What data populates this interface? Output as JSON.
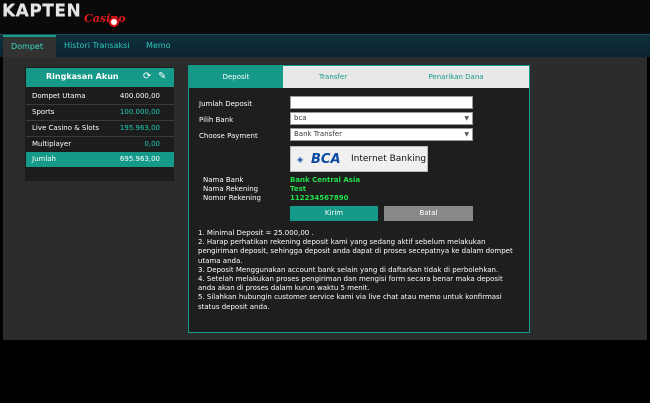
{
  "logo": {
    "main": "KAPTEN",
    "sub": "Casino"
  },
  "nav": {
    "tabs": [
      "Dompet",
      "Histori Transaksi",
      "Memo"
    ],
    "active": 0
  },
  "summary": {
    "title": "Ringkasan Akun",
    "rows": [
      {
        "label": "Dompet Utama",
        "value": "400.000,00"
      },
      {
        "label": "Sports",
        "value": "100.000,00"
      },
      {
        "label": "Live Casino & Slots",
        "value": "195.963,00"
      },
      {
        "label": "Multiplayer",
        "value": "0,00"
      }
    ],
    "total": {
      "label": "Jumlah",
      "value": "695.963,00"
    }
  },
  "deposit": {
    "tabs": [
      "Deposit",
      "Transfer",
      "Penarikan Dana"
    ],
    "form": {
      "amount_label": "Jumlah Deposit",
      "amount_value": "",
      "bank_label": "Pilih Bank",
      "bank_value": "bca",
      "payment_label": "Choose Payment",
      "payment_value": "Bank Transfer"
    },
    "bank_card": {
      "logo": "BCA",
      "label": "Internet Banking"
    },
    "info": [
      {
        "label": "Nama Bank",
        "value": "Bank Central Asia"
      },
      {
        "label": "Nama Rekening",
        "value": "Test"
      },
      {
        "label": "Nomor Rekening",
        "value": "112234567890"
      }
    ],
    "buttons": {
      "submit": "Kirim",
      "cancel": "Batal"
    },
    "notes": [
      "1. Minimal Deposit = 25.000,00 .",
      "2. Harap perhatikan rekening deposit kami yang sedang aktif sebelum melakukan pengiriman deposit, sehingga deposit anda dapat di proses secepatnya ke dalam dompet utama anda.",
      "3. Deposit Menggunakan account bank selain yang di daftarkan tidak di perbolehkan.",
      "4. Setelah melakukan proses pengiriman dan mengisi form secara benar maka deposit anda akan di proses dalam kurun waktu 5 menit.",
      "5. Silahkan hubungin customer service kami via live chat atau memo untuk konfirmasi status deposit anda."
    ]
  },
  "colors": {
    "accent": "#159a8a",
    "nav_text": "#2fc7b8",
    "info_value": "#22e04a"
  }
}
